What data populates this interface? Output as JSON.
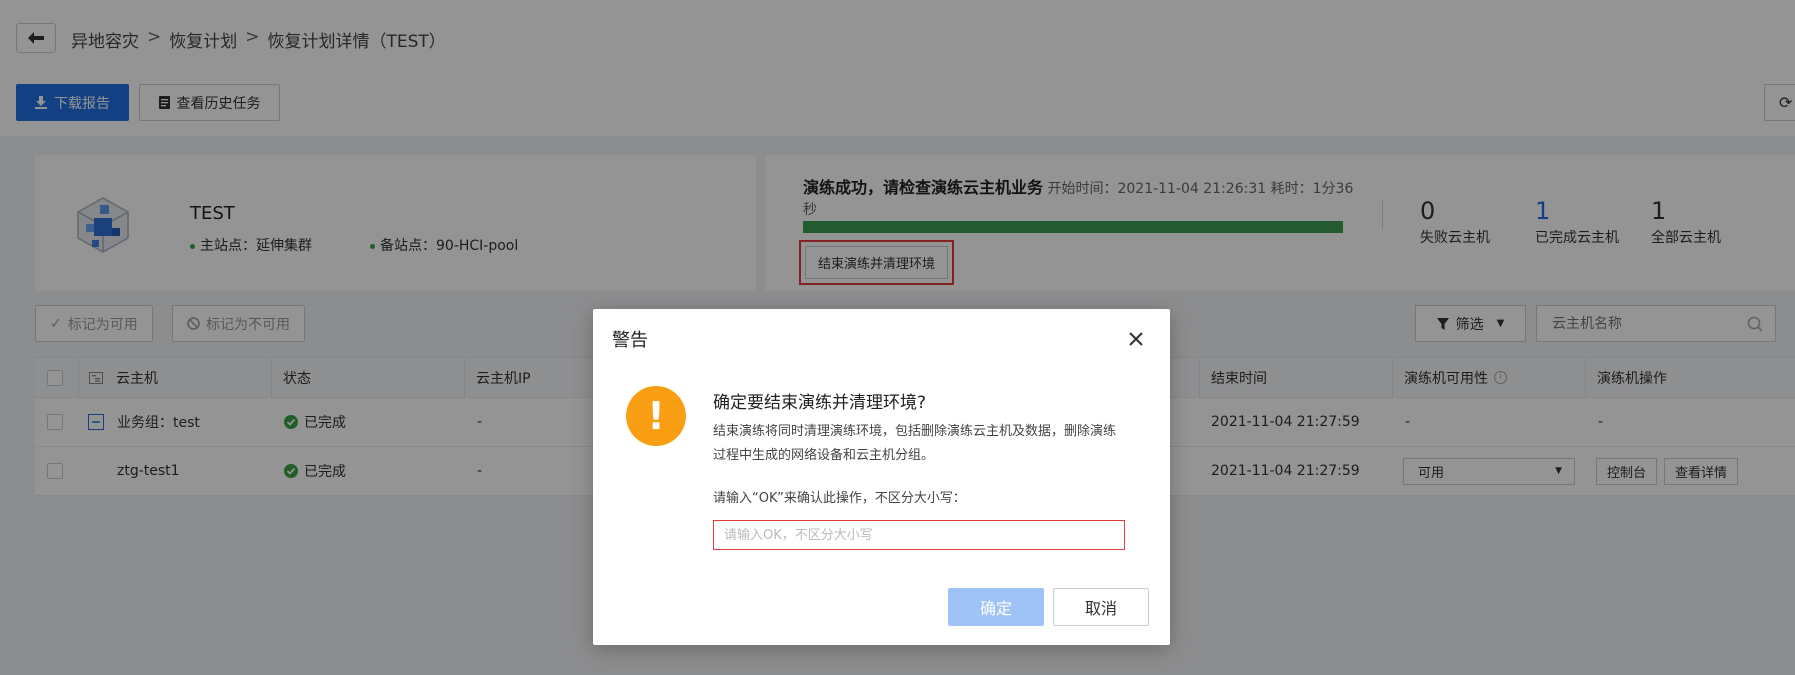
{
  "header": {
    "breadcrumb": [
      "异地容灾",
      "恢复计划",
      "恢复计划详情（TEST）"
    ],
    "separator": ">"
  },
  "toolbar": {
    "download_label": "下载报告",
    "history_label": "查看历史任务"
  },
  "plan": {
    "name": "TEST",
    "main_site": "主站点：延伸集群",
    "backup_site": "备站点：90-HCI-pool"
  },
  "drill": {
    "status_text": "演练成功，请检查演练云主机业务",
    "start_time": "开始时间：2021-11-04 21:26:31",
    "elapsed": "耗时：1分36秒",
    "progress_percent": 100,
    "end_button_label": "结束演练并清理环境",
    "stats": [
      {
        "value": "0",
        "label": "失败云主机",
        "color": "#333333"
      },
      {
        "value": "1",
        "label": "已完成云主机",
        "color": "#1f6fe0"
      },
      {
        "value": "1",
        "label": "全部云主机",
        "color": "#333333"
      }
    ]
  },
  "table_toolbar": {
    "mark_available": "标记为可用",
    "mark_unavailable": "标记为不可用",
    "filter_label": "筛选",
    "search_placeholder": "云主机名称"
  },
  "table": {
    "columns": {
      "vm": "云主机",
      "status": "状态",
      "ip": "云主机IP",
      "end_time": "结束时间",
      "availability": "演练机可用性",
      "actions": "演练机操作"
    },
    "rows": [
      {
        "vm": "业务组：test",
        "status": "已完成",
        "ip": "-",
        "end_time": "2021-11-04 21:27:59",
        "availability": "-",
        "actions": "-"
      },
      {
        "vm": "ztg-test1",
        "status": "已完成",
        "ip": "-",
        "end_time": "2021-11-04 21:27:59",
        "availability": "可用",
        "action_console": "控制台",
        "action_detail": "查看详情"
      }
    ]
  },
  "dialog": {
    "title": "警告",
    "question": "确定要结束演练并清理环境?",
    "description": "结束演练将同时清理演练环境，包括删除演练云主机及数据，删除演练过程中生成的网络设备和云主机分组。",
    "hint": "请输入“OK”来确认此操作，不区分大小写：",
    "input_placeholder": "请输入OK，不区分大小写",
    "input_value": "",
    "ok_label": "确定",
    "cancel_label": "取消"
  },
  "colors": {
    "primary": "#1f6fe0",
    "success": "#3f9c51",
    "warning": "#fa9e14",
    "danger": "#e23c3c"
  }
}
